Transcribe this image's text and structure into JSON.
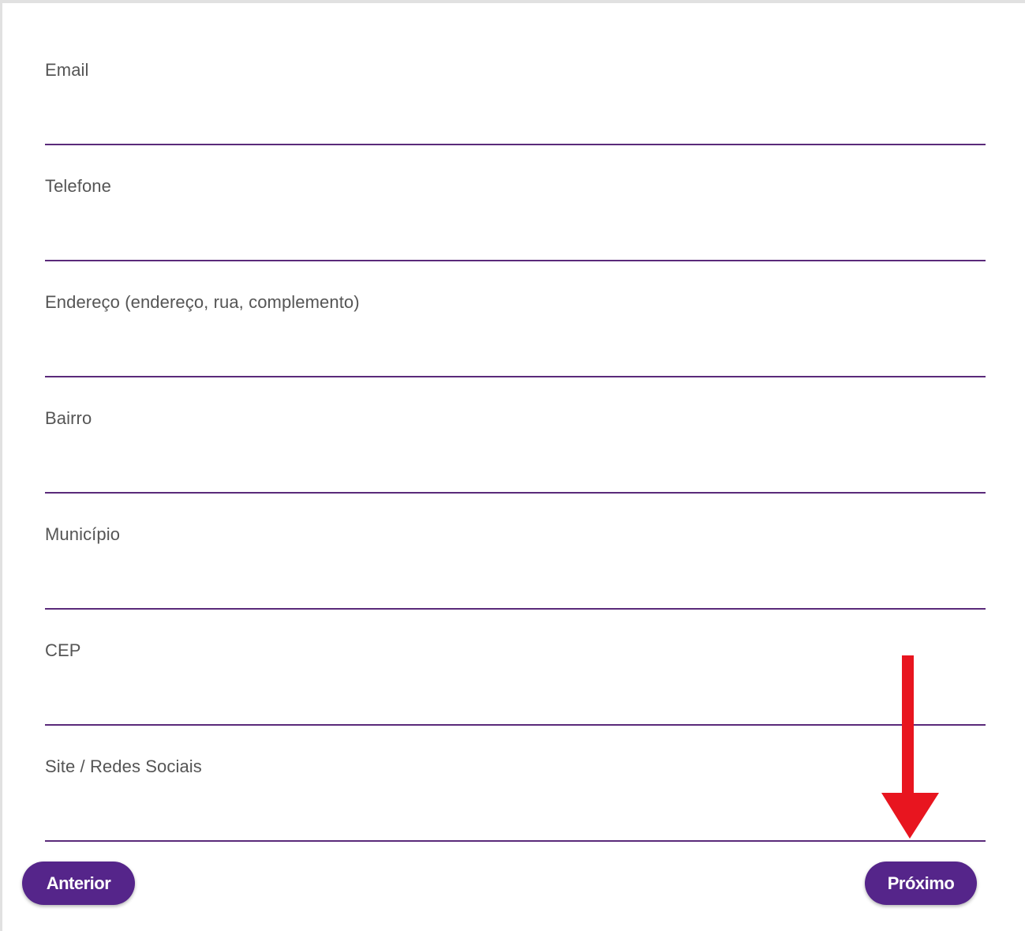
{
  "form": {
    "fields": [
      {
        "label": "Email",
        "value": ""
      },
      {
        "label": "Telefone",
        "value": ""
      },
      {
        "label": "Endereço (endereço, rua, complemento)",
        "value": ""
      },
      {
        "label": "Bairro",
        "value": ""
      },
      {
        "label": "Município",
        "value": ""
      },
      {
        "label": "CEP",
        "value": ""
      },
      {
        "label": "Site / Redes Sociais",
        "value": ""
      }
    ]
  },
  "navigation": {
    "previous_label": "Anterior",
    "next_label": "Próximo"
  },
  "colors": {
    "accent": "#55258a",
    "underline": "#5a2a7a",
    "annotation_arrow": "#e8151f"
  },
  "icons": {
    "annotation": "down-arrow-annotation-icon"
  }
}
